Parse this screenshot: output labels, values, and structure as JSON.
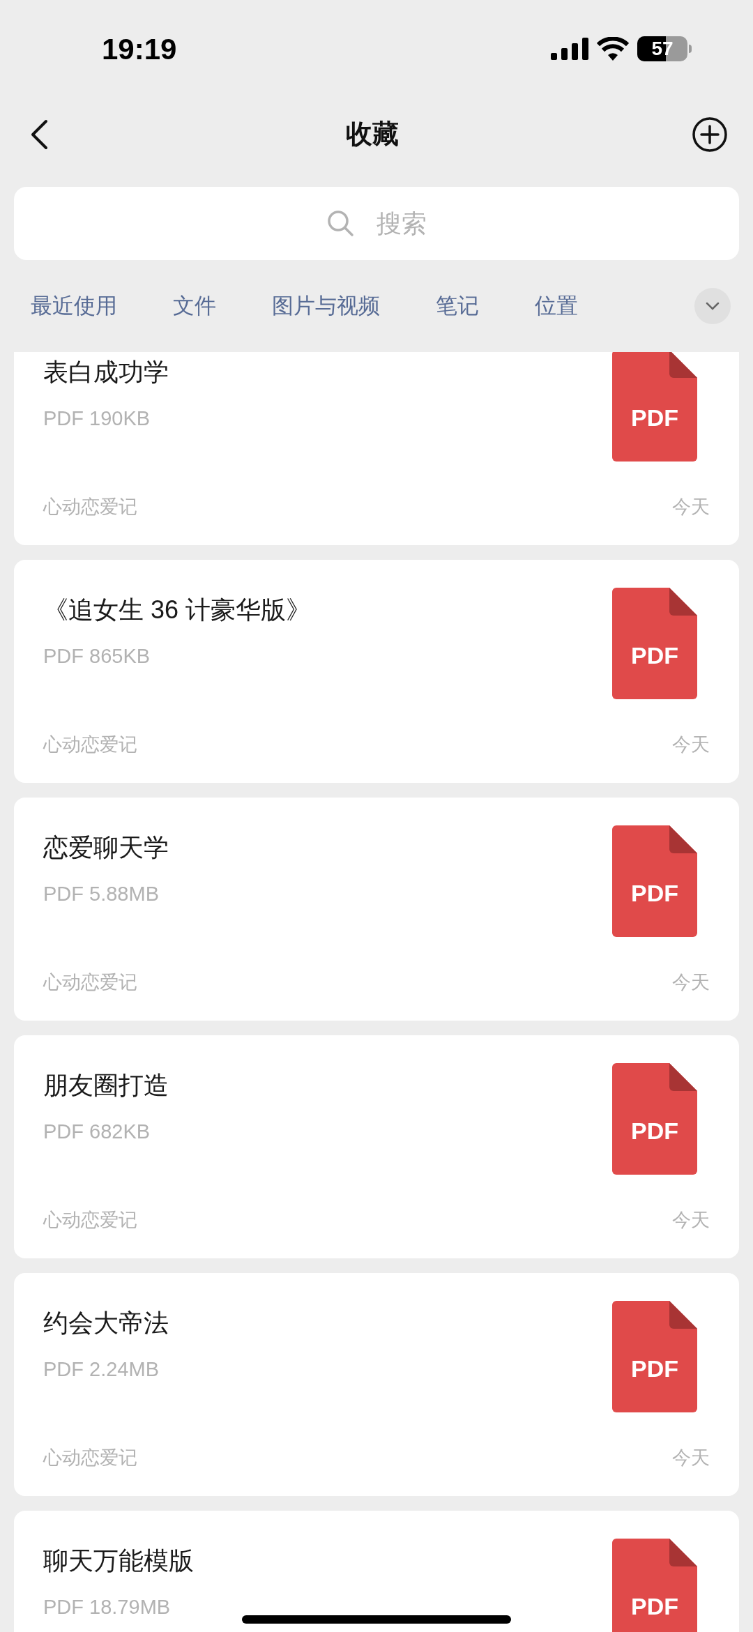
{
  "status_bar": {
    "time": "19:19",
    "battery": "57"
  },
  "nav": {
    "title": "收藏"
  },
  "search": {
    "placeholder": "搜索"
  },
  "tabs": [
    {
      "label": "最近使用"
    },
    {
      "label": "文件"
    },
    {
      "label": "图片与视频"
    },
    {
      "label": "笔记"
    },
    {
      "label": "位置"
    }
  ],
  "items": [
    {
      "title": "表白成功学",
      "size": "PDF 190KB",
      "source": "心动恋爱记",
      "date": "今天",
      "file_type": "PDF"
    },
    {
      "title": "《追女生 36 计豪华版》",
      "size": "PDF 865KB",
      "source": "心动恋爱记",
      "date": "今天",
      "file_type": "PDF"
    },
    {
      "title": "恋爱聊天学",
      "size": "PDF 5.88MB",
      "source": "心动恋爱记",
      "date": "今天",
      "file_type": "PDF"
    },
    {
      "title": "朋友圈打造",
      "size": "PDF 682KB",
      "source": "心动恋爱记",
      "date": "今天",
      "file_type": "PDF"
    },
    {
      "title": "约会大帝法",
      "size": "PDF 2.24MB",
      "source": "心动恋爱记",
      "date": "今天",
      "file_type": "PDF"
    },
    {
      "title": "聊天万能模版",
      "size": "PDF 18.79MB",
      "file_type": "PDF"
    }
  ]
}
